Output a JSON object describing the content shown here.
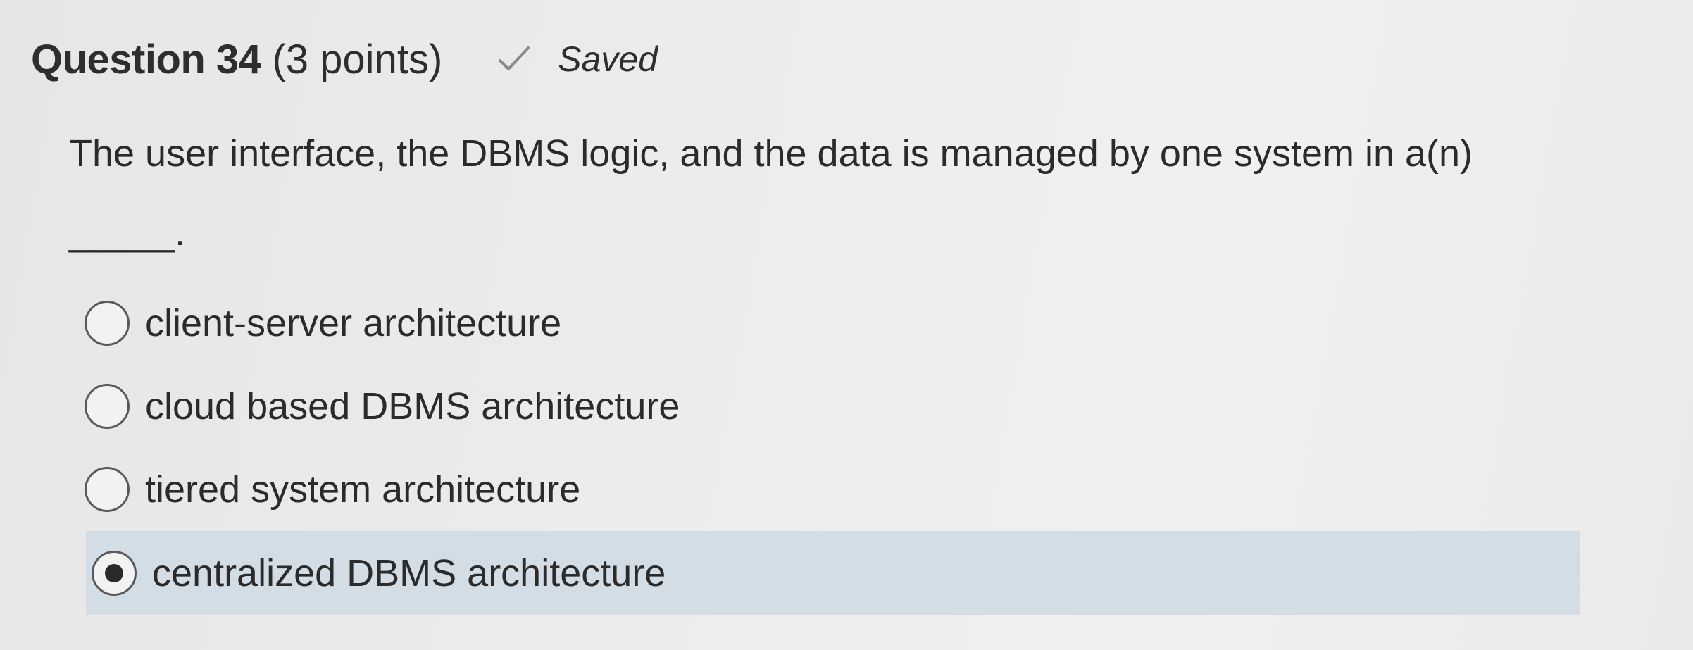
{
  "question": {
    "title": "Question 34",
    "points": "(3 points)",
    "status_icon": "check-icon",
    "status_text": "Saved",
    "prompt_line1": "The user interface, the DBMS logic, and the data is managed by one system in a(n)",
    "prompt_line2": "_____."
  },
  "options": [
    {
      "label": "client-server architecture",
      "selected": false
    },
    {
      "label": "cloud based DBMS architecture",
      "selected": false
    },
    {
      "label": "tiered system architecture",
      "selected": false
    },
    {
      "label": "centralized DBMS architecture",
      "selected": true
    }
  ],
  "colors": {
    "selected_background": "#d2dde6",
    "text": "#2b2b2b",
    "radio_border": "#5a5a5a"
  }
}
